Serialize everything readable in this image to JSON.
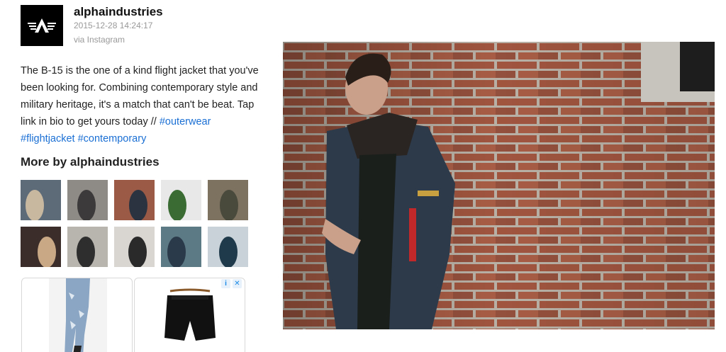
{
  "post": {
    "username": "alphaindustries",
    "timestamp": "2015-12-28 14:24:17",
    "source": "via Instagram",
    "caption_text": "The B-15 is the one of a kind flight jacket that you've been looking for. Combining contemporary style and military heritage, it's a match that can't be beat. Tap link in bio to get yours today // ",
    "hashtags": [
      "#outerwear",
      "#flightjacket",
      "#contemporary"
    ]
  },
  "more": {
    "title": "More by alphaindustries",
    "thumbnails": [
      {
        "name": "thumb-mountain-jacket",
        "colors": [
          "#5d6a78",
          "#c8b8a0"
        ]
      },
      {
        "name": "thumb-street-walk",
        "colors": [
          "#8e8a86",
          "#3c3a3a"
        ]
      },
      {
        "name": "thumb-brick-wall",
        "colors": [
          "#9a5a45",
          "#2b3340"
        ]
      },
      {
        "name": "thumb-red-tag",
        "colors": [
          "#e8e8e8",
          "#3a6b33"
        ]
      },
      {
        "name": "thumb-olive-jackets",
        "colors": [
          "#7d7260",
          "#4a4a3c"
        ]
      },
      {
        "name": "thumb-sunglasses-woman",
        "colors": [
          "#3b2e2a",
          "#c9a886"
        ]
      },
      {
        "name": "thumb-group-street",
        "colors": [
          "#b8b4ae",
          "#2e2e2e"
        ]
      },
      {
        "name": "thumb-seated-woman",
        "colors": [
          "#d9d6d2",
          "#2a2a2a"
        ]
      },
      {
        "name": "thumb-fur-hood",
        "colors": [
          "#5c7a86",
          "#2b3a4a"
        ]
      },
      {
        "name": "thumb-stadium",
        "colors": [
          "#c9d2d8",
          "#1f3a4a"
        ]
      }
    ]
  },
  "ads": {
    "info_icon": "i",
    "close_icon": "✕"
  },
  "colors": {
    "hashtag": "#1a6fd4",
    "meta": "#999999"
  }
}
